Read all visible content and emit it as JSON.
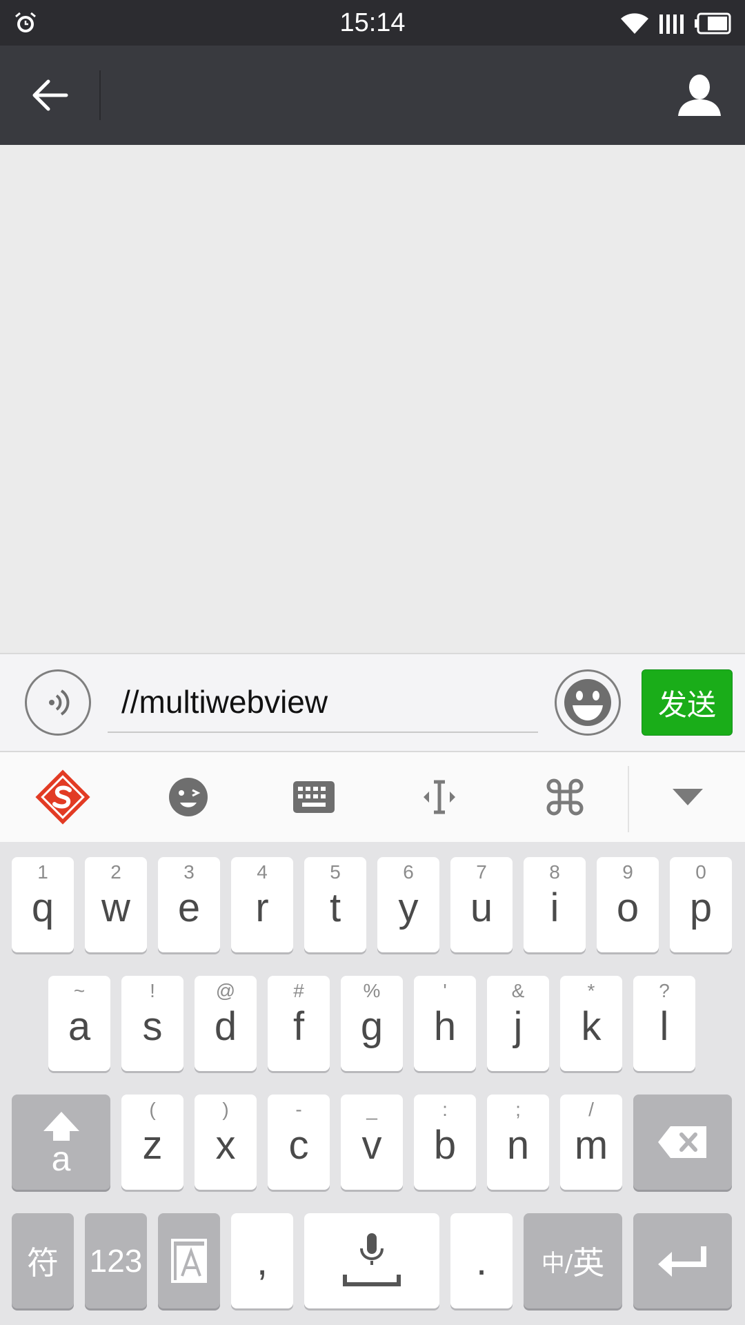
{
  "status_bar": {
    "time": "15:14"
  },
  "input": {
    "value": "//multiwebview"
  },
  "send_label": "发送",
  "keyboard": {
    "row1": [
      {
        "main": "q",
        "sub": "1"
      },
      {
        "main": "w",
        "sub": "2"
      },
      {
        "main": "e",
        "sub": "3"
      },
      {
        "main": "r",
        "sub": "4"
      },
      {
        "main": "t",
        "sub": "5"
      },
      {
        "main": "y",
        "sub": "6"
      },
      {
        "main": "u",
        "sub": "7"
      },
      {
        "main": "i",
        "sub": "8"
      },
      {
        "main": "o",
        "sub": "9"
      },
      {
        "main": "p",
        "sub": "0"
      }
    ],
    "row2": [
      {
        "main": "a",
        "sub": "~"
      },
      {
        "main": "s",
        "sub": "!"
      },
      {
        "main": "d",
        "sub": "@"
      },
      {
        "main": "f",
        "sub": "#"
      },
      {
        "main": "g",
        "sub": "%"
      },
      {
        "main": "h",
        "sub": "'"
      },
      {
        "main": "j",
        "sub": "&"
      },
      {
        "main": "k",
        "sub": "*"
      },
      {
        "main": "l",
        "sub": "?"
      }
    ],
    "row3": [
      {
        "main": "z",
        "sub": "("
      },
      {
        "main": "x",
        "sub": ")"
      },
      {
        "main": "c",
        "sub": "-"
      },
      {
        "main": "v",
        "sub": "_"
      },
      {
        "main": "b",
        "sub": ":"
      },
      {
        "main": "n",
        "sub": ";"
      },
      {
        "main": "m",
        "sub": "/"
      }
    ],
    "shift_label": "a",
    "symbol_label": "符",
    "numbers_label": "123",
    "comma_label": ",",
    "period_label": ".",
    "lang_zh": "中/",
    "lang_en": "英"
  },
  "colors": {
    "send_green": "#1aad19",
    "header": "#393a3f",
    "status_bar": "#2c2c30"
  }
}
